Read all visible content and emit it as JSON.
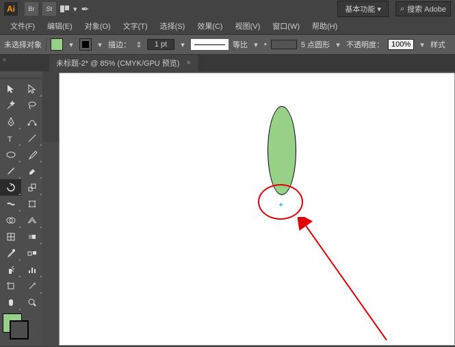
{
  "top": {
    "logo": "Ai",
    "br": "Br",
    "st": "St",
    "workspace": "基本功能",
    "ws_arrow": "▾",
    "search_placeholder": "搜索 Adobe"
  },
  "menu": {
    "file": "文件(F)",
    "edit": "编辑(E)",
    "object": "对象(O)",
    "type": "文字(T)",
    "select": "选择(S)",
    "effect": "效果(C)",
    "view": "视图(V)",
    "window": "窗口(W)",
    "help": "帮助(H)"
  },
  "control": {
    "noselect": "未选择对象",
    "stroke_label": "描边：",
    "stroke_pt": "1 pt",
    "uniform": "等比",
    "brush": "5 点圆形",
    "opacity_label": "不透明度：",
    "opacity": "100%",
    "style": "样式",
    "bullet": "•"
  },
  "tab": {
    "title": "未标题-2* @ 85% (CMYK/GPU 预览)",
    "close": "×"
  },
  "dd": "▾",
  "updn": "⇕",
  "search_icon": "⌕"
}
